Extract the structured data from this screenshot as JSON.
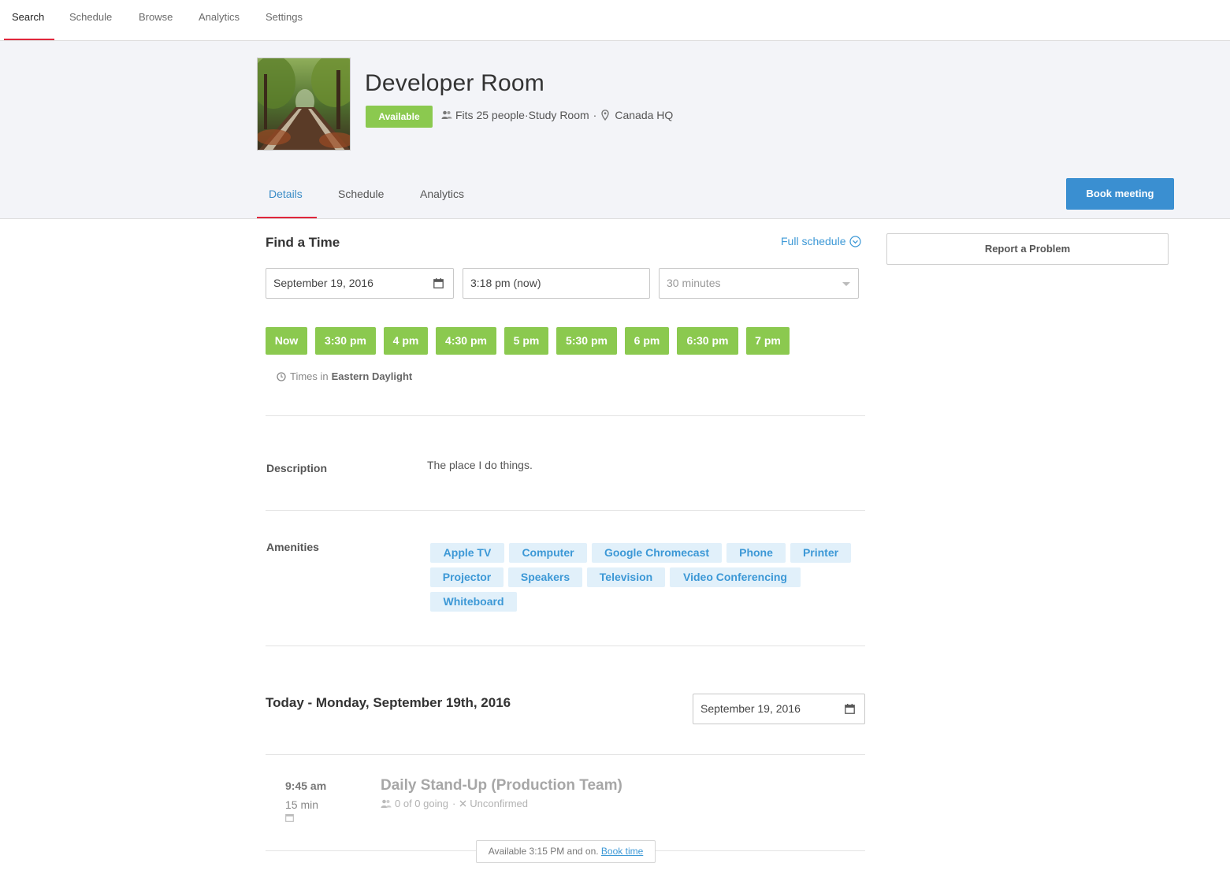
{
  "topnav": {
    "tabs": [
      {
        "label": "Search"
      },
      {
        "label": "Schedule"
      },
      {
        "label": "Browse"
      },
      {
        "label": "Analytics"
      },
      {
        "label": "Settings"
      }
    ],
    "active": "Search"
  },
  "room": {
    "title": "Developer Room",
    "status": "Available",
    "capacity": "Fits 25 people",
    "type": "Study Room",
    "location": "Canada HQ",
    "meta_separator": "·"
  },
  "subtabs": [
    {
      "label": "Details"
    },
    {
      "label": "Schedule"
    },
    {
      "label": "Analytics"
    }
  ],
  "book_button": "Book meeting",
  "report_button": "Report a Problem",
  "find_time": {
    "title": "Find a Time",
    "full_schedule": "Full schedule",
    "date_value": "September 19, 2016",
    "time_value": "3:18 pm (now)",
    "duration_value": "30 minutes",
    "slots": [
      "Now",
      "3:30 pm",
      "4 pm",
      "4:30 pm",
      "5 pm",
      "5:30 pm",
      "6 pm",
      "6:30 pm",
      "7 pm"
    ],
    "timezone_prefix": "Times in",
    "timezone": "Eastern Daylight"
  },
  "description": {
    "label": "Description",
    "text": "The place I do things."
  },
  "amenities": {
    "label": "Amenities",
    "items": [
      "Apple TV",
      "Computer",
      "Google Chromecast",
      "Phone",
      "Printer",
      "Projector",
      "Speakers",
      "Television",
      "Video Conferencing",
      "Whiteboard"
    ]
  },
  "schedule_day": {
    "title": "Today - Monday, September 19th, 2016",
    "date_value": "September 19, 2016"
  },
  "event": {
    "time": "9:45 am",
    "duration": "15 min",
    "title": "Daily Stand-Up (Production Team)",
    "attendance": "0 of 0 going",
    "separator": "·",
    "status": "Unconfirmed"
  },
  "availability": {
    "text": "Available 3:15 PM and on.",
    "link": "Book time"
  },
  "colors": {
    "accent_red": "#e0263c",
    "available_green": "#8bc94f",
    "link_blue": "#3c98d6",
    "button_blue": "#3a8fd1",
    "tag_bg": "#e1f0fa"
  }
}
